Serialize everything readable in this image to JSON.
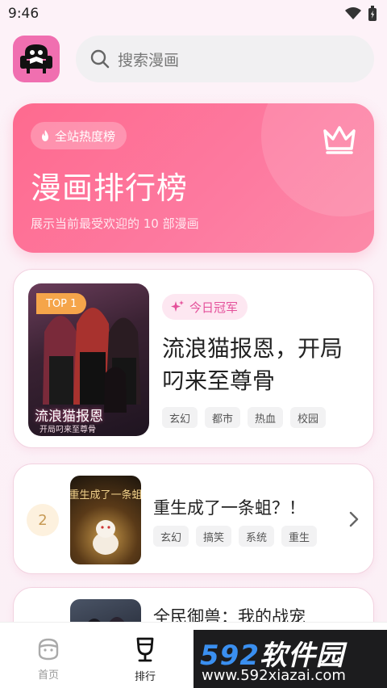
{
  "status_bar": {
    "time": "9:46"
  },
  "search": {
    "placeholder": "搜索漫画"
  },
  "hero": {
    "badge": "全站热度榜",
    "title": "漫画排行榜",
    "subtitle": "展示当前最受欢迎的 10 部漫画"
  },
  "ranking": [
    {
      "rank_badge": "TOP 1",
      "champion_label": "今日冠军",
      "title": "流浪猫报恩，开局叼来至尊骨",
      "cover_title": "流浪猫报恩",
      "cover_subtitle": "开局叼来至尊骨",
      "tags": [
        "玄幻",
        "都市",
        "热血",
        "校园"
      ]
    },
    {
      "rank": "2",
      "title": "重生成了一条蛆？！",
      "cover_title": "重生成了一条蛆",
      "tags": [
        "玄幻",
        "搞笑",
        "系统",
        "重生"
      ]
    },
    {
      "title": "全民御兽：我的战宠"
    }
  ],
  "tabbar": {
    "home": "首页",
    "rank": "排行"
  },
  "watermark": {
    "brand_num": "592",
    "brand_text": "软件园",
    "url": "www.592xiazai.com"
  },
  "colors": {
    "accent_pink": "#fe6a8f",
    "champion_pink": "#e4509a",
    "top_badge": "#f5a54a"
  }
}
